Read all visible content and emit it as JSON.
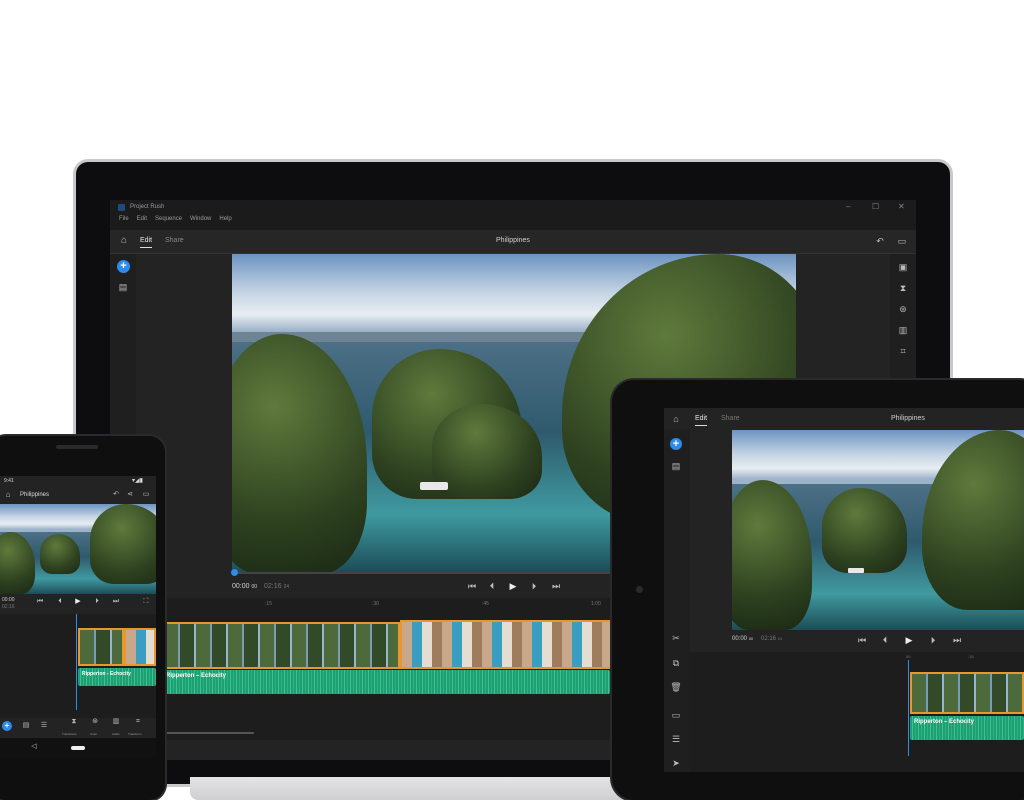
{
  "desktop": {
    "app_title": "Project Rush",
    "menu": [
      "File",
      "Edit",
      "Sequence",
      "Window",
      "Help"
    ],
    "tabs": [
      "Edit",
      "Share"
    ],
    "project_title": "Philippines",
    "timecode_current": "00:00",
    "timecode_current_frames": "00",
    "timecode_total": "02:16",
    "timecode_total_frames": "24",
    "ruler": [
      ":15",
      ":30",
      ":45",
      "1:00"
    ],
    "audio_track": "Ripperton – Echocity",
    "icons": {
      "home": "home-icon",
      "add": "add-media-icon",
      "projects": "projects-icon",
      "undo": "undo-icon",
      "comment": "comment-icon"
    }
  },
  "phone": {
    "status_time": "9:41",
    "project_title": "Philippines",
    "timecode_current": "00:00",
    "timecode_total": "02:16",
    "audio_track": "Ripperton - Echocity",
    "tools": [
      "Transitions",
      "Color",
      "Audio",
      "Transform"
    ]
  },
  "tablet": {
    "tabs": [
      "Edit",
      "Share"
    ],
    "project_title": "Philippines",
    "timecode_current": "00:00",
    "timecode_current_frames": "00",
    "timecode_total": "02:16",
    "timecode_total_frames": "24",
    "ruler": [
      "00",
      ":15"
    ],
    "audio_track": "Ripperton – Echocity"
  },
  "colors": {
    "accent": "#2d8ceb",
    "clip_border": "#e8962e",
    "audio": "#2eb282",
    "panel": "#232323"
  }
}
